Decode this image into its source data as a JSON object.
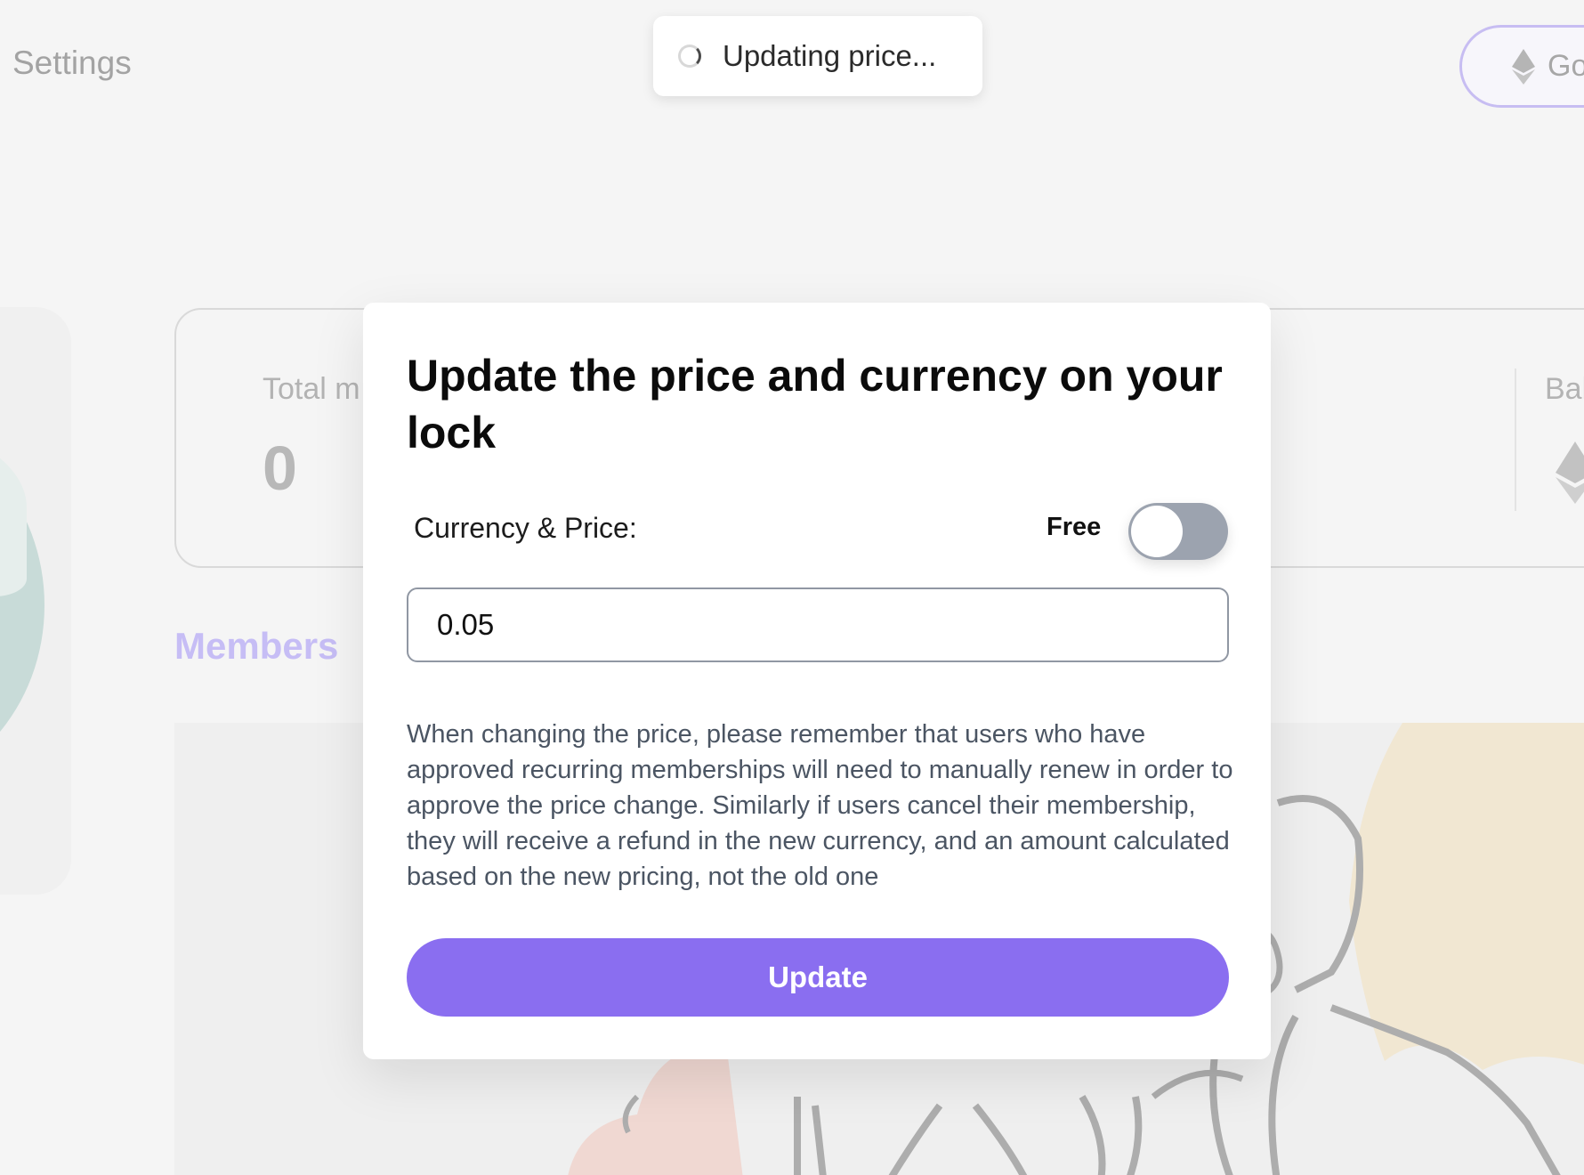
{
  "nav": {
    "settings_label": "Settings"
  },
  "network_button": {
    "label": "Go",
    "icon": "ethereum-icon"
  },
  "stats": {
    "total_members_label": "Total m",
    "total_members_value": "0",
    "balance_label": "Bal",
    "balance_icon": "ethereum-icon"
  },
  "members": {
    "heading": "Members"
  },
  "toast": {
    "text": "Updating price...",
    "icon": "spinner-icon"
  },
  "modal": {
    "title": "Update the price and currency on your lock",
    "currency_price_label": "Currency & Price:",
    "free_label": "Free",
    "free_toggle_on": false,
    "price_value": "0.05",
    "info_text": "When changing the price, please remember that users who have approved recurring memberships will need to manually renew in order to approve the price change. Similarly if users cancel their membership, they will receive a refund in the new currency, and an amount calculated based on the new pricing, not the old one",
    "update_button": "Update"
  },
  "colors": {
    "accent": "#8a6ef0",
    "members_heading": "#c6bdf5",
    "toggle_track": "#9ca3af",
    "page_background": "#f5f5f5"
  }
}
